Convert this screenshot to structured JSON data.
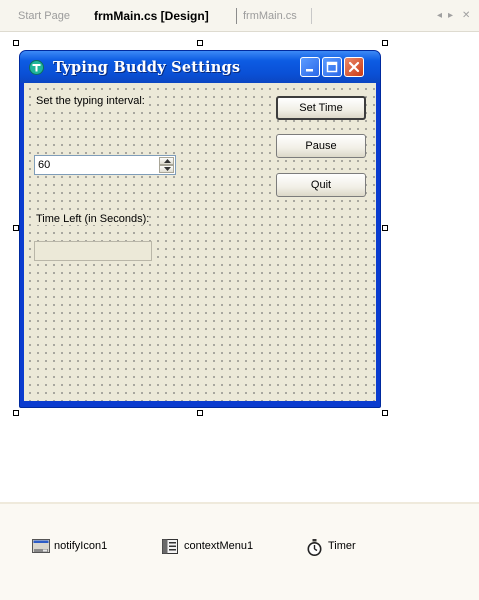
{
  "tabs": {
    "start_page": "Start Page",
    "design": "frmMain.cs [Design]",
    "code": "frmMain.cs",
    "nav_left": "◂",
    "nav_right": "▸",
    "close": "✕"
  },
  "form": {
    "title": "Typing Buddy Settings",
    "interval_label": "Set the typing interval:",
    "interval_value": "60",
    "time_left_label": "Time Left (in Seconds):",
    "time_left_value": "",
    "buttons": {
      "set_time": "Set Time",
      "pause": "Pause",
      "quit": "Quit"
    }
  },
  "tray": {
    "items": [
      {
        "label": "notifyIcon1",
        "icon": "notify-icon"
      },
      {
        "label": "contextMenu1",
        "icon": "context-menu-icon"
      },
      {
        "label": "Timer",
        "icon": "timer-icon"
      }
    ]
  },
  "colors": {
    "titlebar": "#0a50d6",
    "client": "#ece9d8",
    "close_button": "#cc3a14"
  }
}
